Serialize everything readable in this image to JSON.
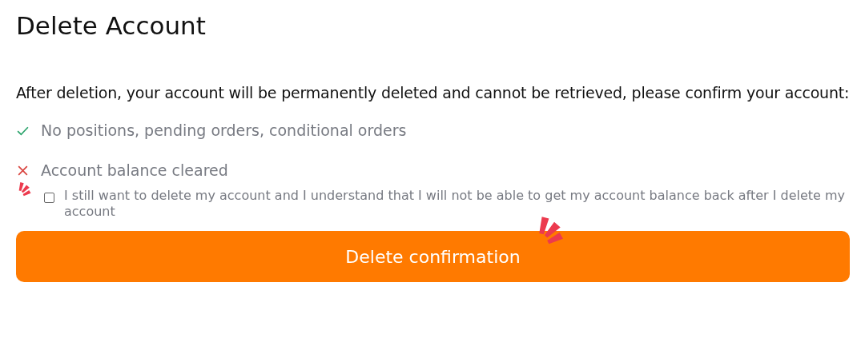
{
  "title": "Delete Account",
  "description": "After deletion, your account will be permanently deleted and cannot be retrieved, please confirm your account:",
  "conditions": [
    {
      "label": "No positions, pending orders, conditional orders",
      "met": true
    },
    {
      "label": "Account balance cleared",
      "met": false
    }
  ],
  "agreement": {
    "label": "I still want to delete my account and I understand that I will not be able to get my account balance back after I delete my account",
    "checked": false
  },
  "button": "Delete confirmation"
}
